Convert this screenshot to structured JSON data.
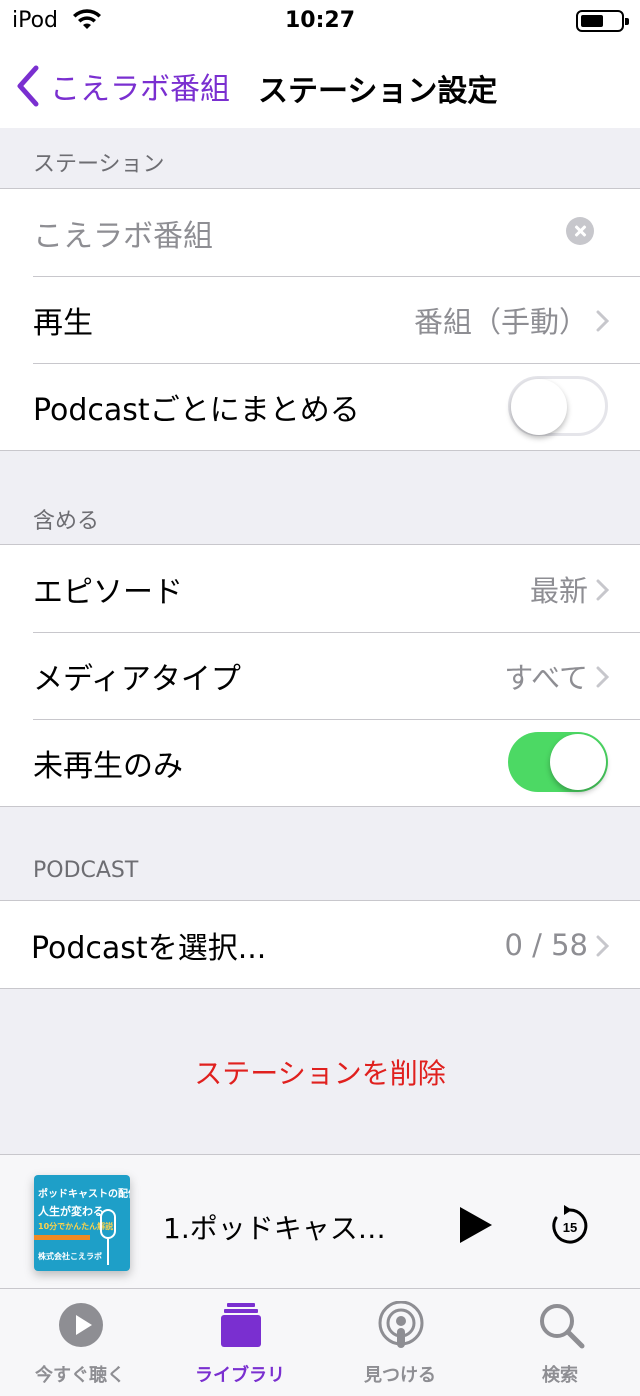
{
  "status_bar": {
    "carrier": "iPod",
    "time": "10:27"
  },
  "nav": {
    "back_label": "こえラボ番組",
    "title": "ステーション設定"
  },
  "station_section": {
    "header": "ステーション",
    "name_input_value": "こえラボ番組",
    "playback_label": "再生",
    "playback_value": "番組（手動）",
    "group_by_podcast_label": "Podcastごとにまとめる",
    "group_by_podcast_on": false
  },
  "include_section": {
    "header": "含める",
    "episodes_label": "エピソード",
    "episodes_value": "最新",
    "media_type_label": "メディアタイプ",
    "media_type_value": "すべて",
    "unplayed_only_label": "未再生のみ",
    "unplayed_only_on": true
  },
  "podcast_section": {
    "header": "PODCAST",
    "select_label": "Podcastを選択...",
    "select_value": "0 / 58"
  },
  "delete_label": "ステーションを削除",
  "mini_player": {
    "artwork_line1": "ポッドキャストの配信で",
    "artwork_line2": "人生が変わる",
    "artwork_line3": "10分でかんたん解説",
    "artwork_line4": "株式会社こえラボ",
    "episode_title": "1.ポッドキャス…",
    "skip_seconds": "15"
  },
  "tabs": [
    {
      "label": "今すぐ聴く",
      "icon": "play-circle-icon"
    },
    {
      "label": "ライブラリ",
      "icon": "library-stack-icon"
    },
    {
      "label": "見つける",
      "icon": "podcast-icon"
    },
    {
      "label": "検索",
      "icon": "search-icon"
    }
  ],
  "colors": {
    "accent": "#7a2fd0",
    "destructive": "#e0201e",
    "toggle_on": "#4cd964",
    "background": "#efeff4"
  }
}
